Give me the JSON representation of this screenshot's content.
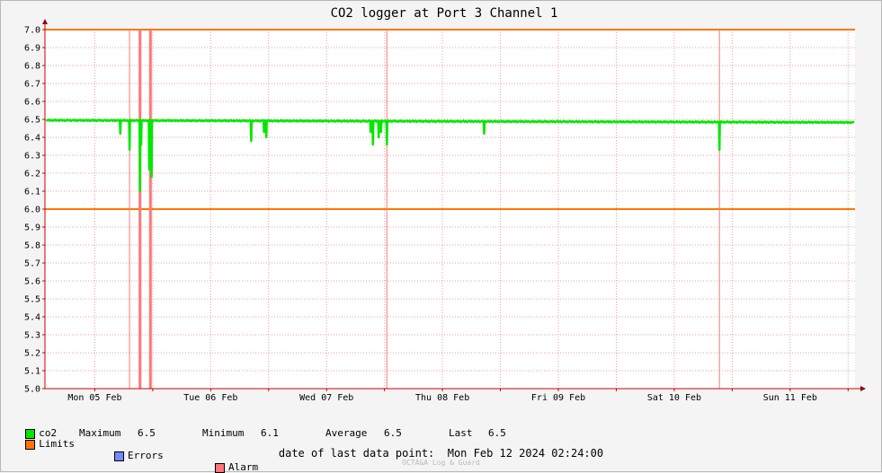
{
  "chart_data": {
    "type": "line",
    "title": "CO2 logger at Port 3 Channel 1",
    "ylim": [
      5.0,
      7.0
    ],
    "y_ticks": [
      "5.0",
      "5.1",
      "5.2",
      "5.3",
      "5.4",
      "5.5",
      "5.6",
      "5.7",
      "5.8",
      "5.9",
      "6.0",
      "6.1",
      "6.2",
      "6.3",
      "6.4",
      "6.5",
      "6.6",
      "6.7",
      "6.8",
      "6.9",
      "7.0"
    ],
    "x_ticks": [
      "Mon 05 Feb",
      "Tue 06 Feb",
      "Wed 07 Feb",
      "Thu 08 Feb",
      "Fri 09 Feb",
      "Sat 10 Feb",
      "Sun 11 Feb"
    ],
    "grid": true,
    "limits": [
      6.0,
      7.0
    ],
    "series": [
      {
        "name": "co2",
        "color": "#00e800",
        "baseline": 6.49,
        "dips": [
          {
            "day": 0.22,
            "value": 6.42
          },
          {
            "day": 0.3,
            "value": 6.33
          },
          {
            "day": 0.39,
            "value": 6.1
          },
          {
            "day": 0.4,
            "value": 6.36
          },
          {
            "day": 0.47,
            "value": 6.22
          },
          {
            "day": 0.49,
            "value": 6.18
          },
          {
            "day": 1.35,
            "value": 6.38
          },
          {
            "day": 1.46,
            "value": 6.43
          },
          {
            "day": 1.48,
            "value": 6.4
          },
          {
            "day": 2.38,
            "value": 6.43
          },
          {
            "day": 2.4,
            "value": 6.36
          },
          {
            "day": 2.45,
            "value": 6.4
          },
          {
            "day": 2.47,
            "value": 6.43
          },
          {
            "day": 2.52,
            "value": 6.36
          },
          {
            "day": 3.36,
            "value": 6.42
          },
          {
            "day": 5.39,
            "value": 6.33
          }
        ]
      }
    ],
    "alarms": [
      {
        "day": 0.3,
        "thick": false
      },
      {
        "day": 0.39,
        "thick": true
      },
      {
        "day": 0.48,
        "thick": true
      },
      {
        "day": 2.52,
        "thick": false
      },
      {
        "day": 5.39,
        "thick": false
      }
    ]
  },
  "legend": {
    "co2_label": "co2",
    "max_label": "Maximum",
    "max_value": "6.5",
    "min_label": "Minimum",
    "min_value": "6.1",
    "avg_label": "Average",
    "avg_value": "6.5",
    "last_label": "Last",
    "last_value": "6.5",
    "limits_label": "Limits",
    "errors_label": "Errors",
    "alarm_label": "Alarm",
    "co2_color": "#00e800",
    "limits_color": "#ff7700",
    "errors_color": "#7788ff",
    "alarm_color": "#ff7777"
  },
  "footer": {
    "text": "date of last data point:  Mon Feb 12 2024 02:24:00",
    "watermark": "OCTA&A Log & Guard"
  }
}
